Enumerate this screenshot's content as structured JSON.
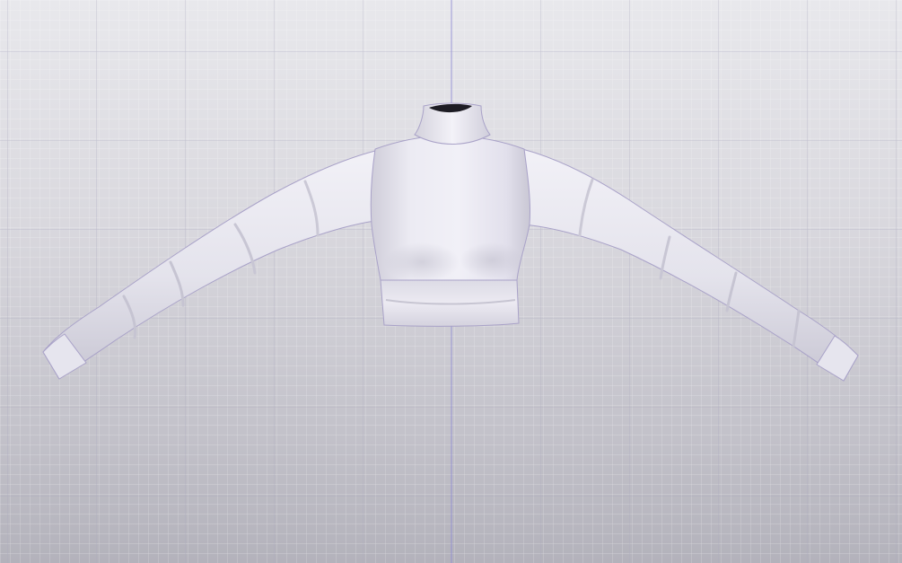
{
  "viewport": {
    "object": "turtleneck-long-sleeve-crop-top",
    "material_color": "#e9e8f0",
    "background_color_top": "#e8e8ec",
    "background_color_bottom": "#b3b2bb",
    "grid_minor_color": "#ffffff",
    "grid_major_color": "#b9b8c8",
    "axis_color": "#8d8ad6"
  }
}
